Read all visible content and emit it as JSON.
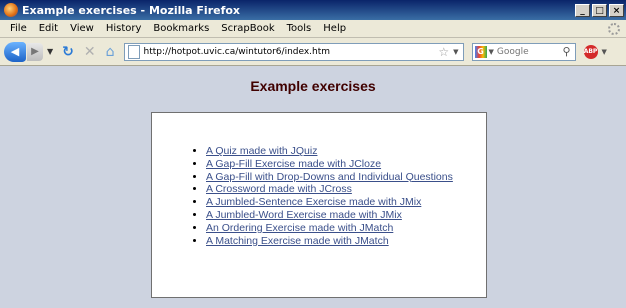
{
  "window": {
    "title": "Example exercises - Mozilla Firefox",
    "buttons": [
      "_",
      "□",
      "×"
    ]
  },
  "menu": [
    "File",
    "Edit",
    "View",
    "History",
    "Bookmarks",
    "ScrapBook",
    "Tools",
    "Help"
  ],
  "navbar": {
    "url": "http://hotpot.uvic.ca/wintutor6/index.htm",
    "search_placeholder": "Google",
    "icons": [
      "back-icon",
      "forward-icon",
      "reload-icon",
      "stop-icon",
      "home-icon",
      "bookmark-star-icon",
      "google-icon",
      "search-icon",
      "adblock-icon"
    ]
  },
  "page": {
    "title": "Example exercises",
    "background": "#cdd3e0",
    "title_color": "#400000",
    "link_color": "#3a4f8a",
    "exercises": [
      "A Quiz made with JQuiz",
      "A Gap-Fill Exercise made with JCloze",
      "A Gap-Fill with Drop-Downs and Individual Questions",
      "A Crossword made with JCross",
      "A Jumbled-Sentence Exercise made with JMix",
      "A Jumbled-Word Exercise made with JMix",
      "An Ordering Exercise made with JMatch",
      "A Matching Exercise made with JMatch"
    ]
  }
}
